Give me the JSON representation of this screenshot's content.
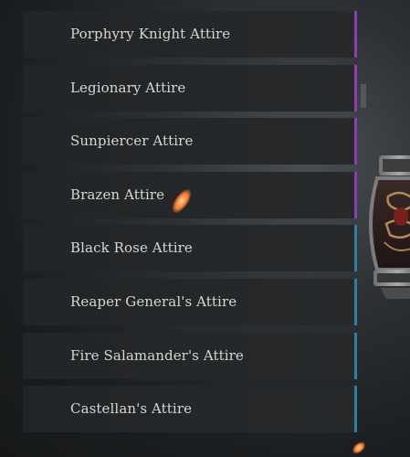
{
  "attire_list": {
    "items": [
      {
        "label": "Porphyry Knight Attire",
        "rarity_color": "#8b3fb0"
      },
      {
        "label": "Legionary Attire",
        "rarity_color": "#8b3fb0"
      },
      {
        "label": "Sunpiercer Attire",
        "rarity_color": "#8b3fb0"
      },
      {
        "label": "Brazen Attire",
        "rarity_color": "#8b3fb0"
      },
      {
        "label": "Black Rose Attire",
        "rarity_color": "#2f7fa3"
      },
      {
        "label": "Reaper General's Attire",
        "rarity_color": "#2f7fa3"
      },
      {
        "label": "Fire Salamander's Attire",
        "rarity_color": "#2f7fa3"
      },
      {
        "label": "Castellan's Attire",
        "rarity_color": "#2f7fa3"
      }
    ]
  },
  "preview": {
    "icon": "armor-preview-icon"
  }
}
